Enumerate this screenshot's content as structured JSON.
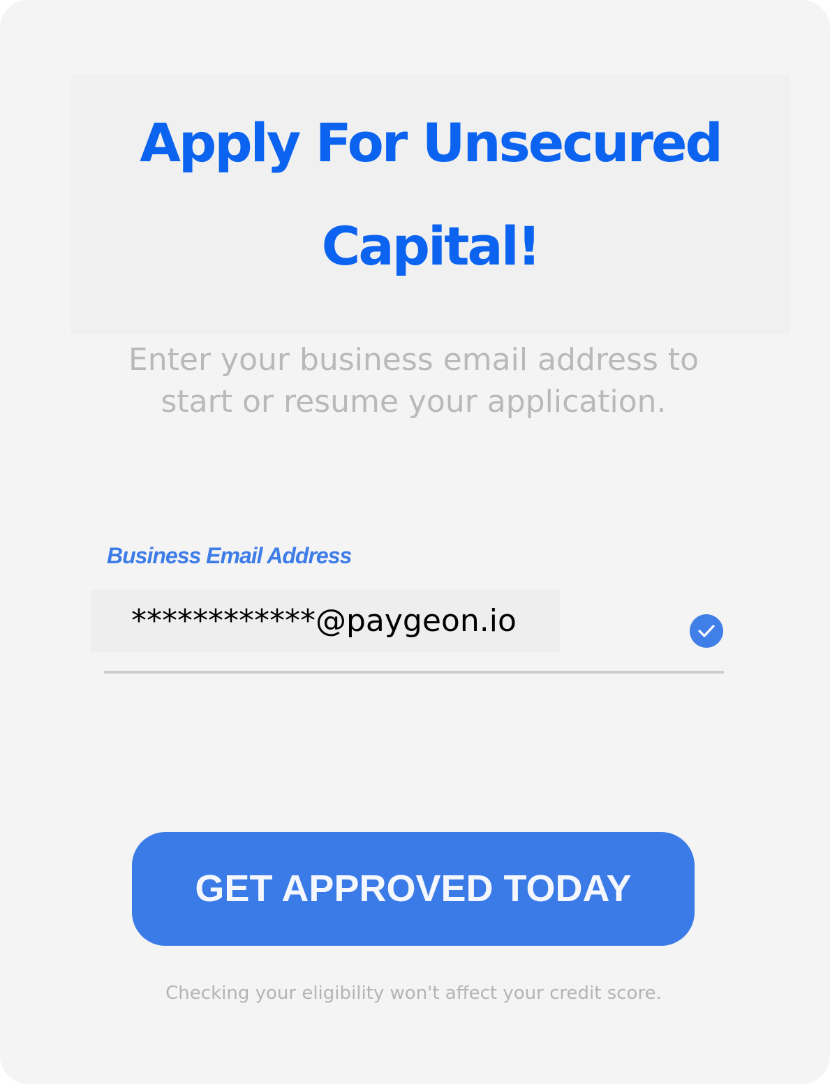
{
  "hero": {
    "title_line1": "Apply For Unsecured",
    "title_line2": "Capital!"
  },
  "form": {
    "instruction_line1": "Enter your business email address to",
    "instruction_line2": "start or resume your application.",
    "email_label": "Business Email Address",
    "email_value": "************@paygeon.io",
    "email_status": "check-circle-icon",
    "submit_label": "GET APPROVED TODAY",
    "disclaimer": "Checking your eligibility won't affect your credit score."
  },
  "colors": {
    "accent": "#3a7be7",
    "title": "#0b63f0",
    "background": "#f4f4f4"
  }
}
